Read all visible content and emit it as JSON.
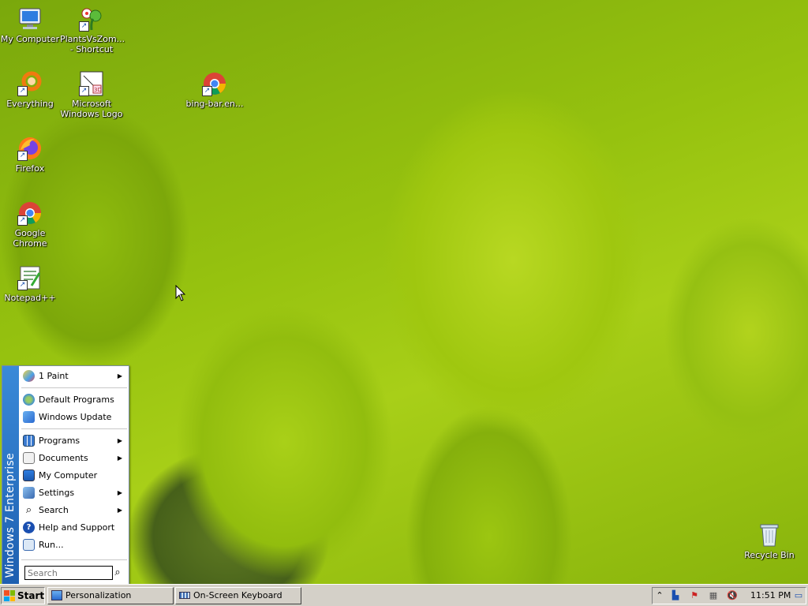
{
  "desktop": {
    "icons": [
      {
        "label": "My Computer"
      },
      {
        "label": "PlantsVsZom... - Shortcut"
      },
      {
        "label": "Everything"
      },
      {
        "label": "Microsoft Windows Logo"
      },
      {
        "label": "bing-bar.en..."
      },
      {
        "label": "Firefox"
      },
      {
        "label": "Google Chrome"
      },
      {
        "label": "Notepad++"
      }
    ],
    "recycle_bin": "Recycle Bin"
  },
  "start_menu": {
    "side_label": "Windows 7 Enterprise",
    "pinned": [
      {
        "label": "1 Paint"
      }
    ],
    "top_items": [
      {
        "label": "Default Programs"
      },
      {
        "label": "Windows Update"
      }
    ],
    "items": [
      {
        "label": "Programs"
      },
      {
        "label": "Documents"
      },
      {
        "label": "My Computer"
      },
      {
        "label": "Settings"
      },
      {
        "label": "Search"
      },
      {
        "label": "Help and Support"
      },
      {
        "label": "Run..."
      }
    ],
    "search_placeholder": "Search"
  },
  "taskbar": {
    "start_label": "Start",
    "tasks": [
      {
        "label": "Personalization"
      },
      {
        "label": "On-Screen Keyboard"
      }
    ],
    "clock": "11:51 PM"
  },
  "colors": {
    "start_side": "#1e5fb0",
    "taskbar": "#d4d0c8"
  }
}
